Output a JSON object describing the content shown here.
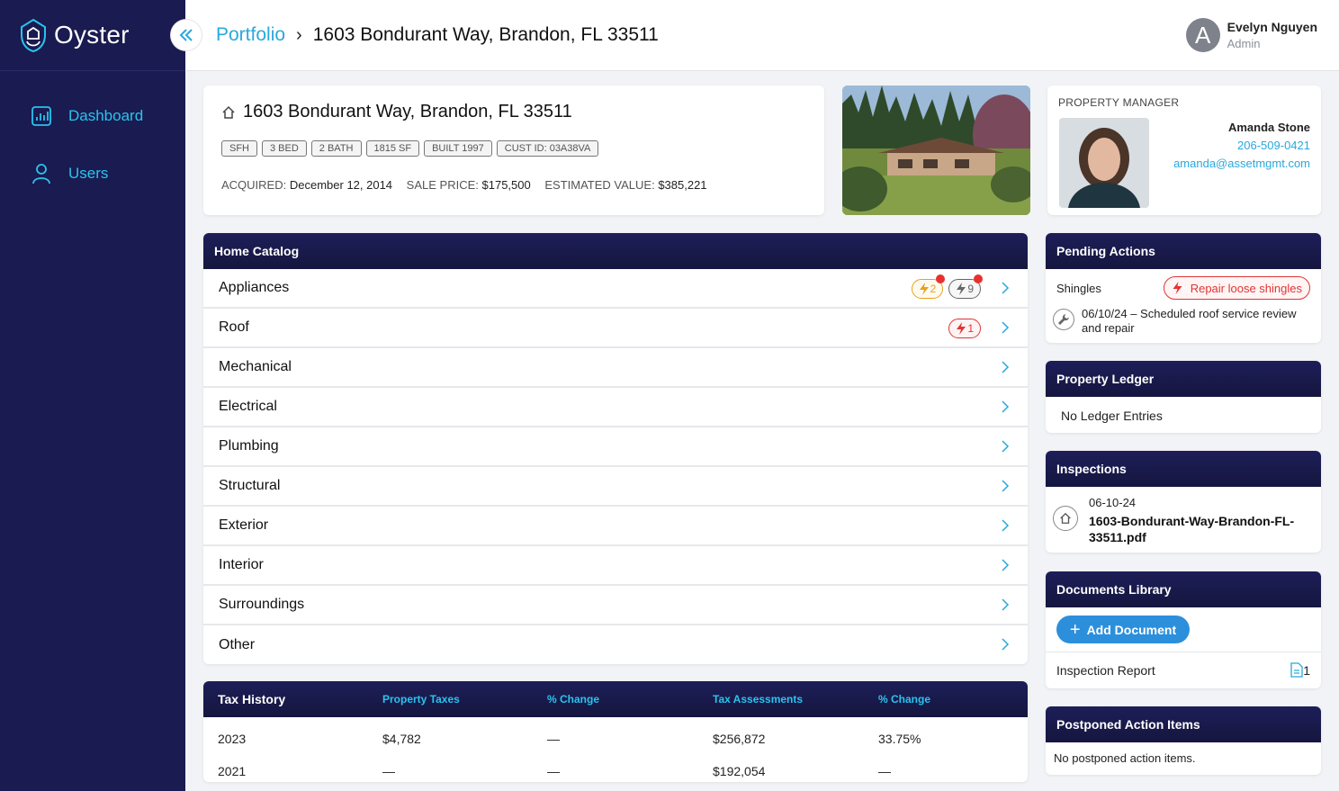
{
  "app": {
    "name": "Oyster"
  },
  "sidebar": {
    "items": [
      {
        "label": "Dashboard",
        "icon": "chart-icon"
      },
      {
        "label": "Users",
        "icon": "user-icon"
      }
    ]
  },
  "breadcrumb": {
    "parent": "Portfolio",
    "current": "1603 Bondurant Way, Brandon, FL 33511"
  },
  "user": {
    "initial": "A",
    "name": "Evelyn Nguyen",
    "role": "Admin"
  },
  "property": {
    "address": "1603 Bondurant Way, Brandon, FL 33511",
    "tags": [
      "SFH",
      "3 BED",
      "2 BATH",
      "1815 SF",
      "BUILT 1997",
      "CUST ID: 03A38VA"
    ],
    "acquired_label": "ACQUIRED:",
    "acquired": "December 12, 2014",
    "sale_label": "SALE PRICE:",
    "sale": "$175,500",
    "est_label": "ESTIMATED VALUE:",
    "est": "$385,221"
  },
  "manager": {
    "heading": "PROPERTY MANAGER",
    "name": "Amanda Stone",
    "phone": "206-509-0421",
    "email": "amanda@assetmgmt.com"
  },
  "catalog": {
    "title": "Home Catalog",
    "rows": [
      {
        "label": "Appliances",
        "badges": [
          {
            "count": "2",
            "kind": "yellow"
          },
          {
            "count": "9",
            "kind": "gray"
          }
        ]
      },
      {
        "label": "Roof",
        "badges": [
          {
            "count": "1",
            "kind": "red"
          }
        ]
      },
      {
        "label": "Mechanical"
      },
      {
        "label": "Electrical"
      },
      {
        "label": "Plumbing"
      },
      {
        "label": "Structural"
      },
      {
        "label": "Exterior"
      },
      {
        "label": "Interior"
      },
      {
        "label": "Surroundings"
      },
      {
        "label": "Other"
      }
    ]
  },
  "tax": {
    "title": "Tax History",
    "headers": [
      "Property Taxes",
      "% Change",
      "Tax Assessments",
      "% Change"
    ],
    "rows": [
      [
        "2023",
        "$4,782",
        "—",
        "$256,872",
        "33.75%"
      ],
      [
        "2021",
        "—",
        "—",
        "$192,054",
        "—"
      ]
    ]
  },
  "pending": {
    "title": "Pending Actions",
    "item_label": "Shingles",
    "action": "Repair loose shingles",
    "schedule": "06/10/24 – Scheduled roof service review and repair"
  },
  "ledger": {
    "title": "Property Ledger",
    "empty": "No Ledger Entries"
  },
  "inspections": {
    "title": "Inspections",
    "date": "06-10-24",
    "file": "1603-Bondurant-Way-Brandon-FL-33511.pdf"
  },
  "documents": {
    "title": "Documents Library",
    "add_label": "Add Document",
    "items": [
      {
        "name": "Inspection Report",
        "count": "1"
      }
    ]
  },
  "postponed": {
    "title": "Postponed Action Items",
    "empty": "No postponed action items."
  },
  "colors": {
    "sidebar": "#1a1b50",
    "accent": "#29c4ee",
    "link": "#29a8dc",
    "danger": "#e03535",
    "warning": "#e6a11a",
    "primary_button": "#2c8fdc"
  }
}
